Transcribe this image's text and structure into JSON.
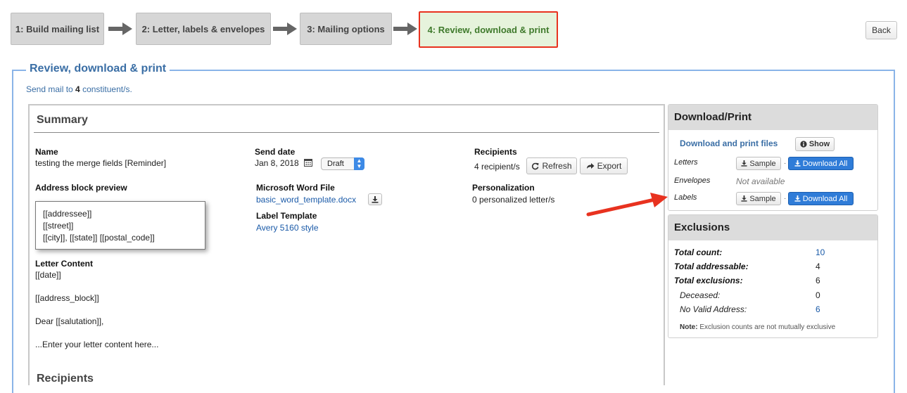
{
  "wizard": {
    "steps": [
      {
        "label": "1: Build mailing list"
      },
      {
        "label": "2: Letter, labels & envelopes"
      },
      {
        "label": "3: Mailing options"
      },
      {
        "label": "4: Review, download & print"
      }
    ],
    "back_label": "Back"
  },
  "page": {
    "legend": "Review, download & print",
    "send_prefix": "Send mail to ",
    "send_count": "4",
    "send_suffix": " constituent/s."
  },
  "summary": {
    "title": "Summary",
    "name_label": "Name",
    "name_value": "testing the merge fields [Reminder]",
    "address_label": "Address block preview",
    "address_lines": [
      "[[addressee]]",
      "[[street]]",
      "[[city]], [[state]] [[postal_code]]"
    ],
    "letter_label": "Letter Content",
    "letter_lines": [
      "[[date]]",
      "[[address_block]]",
      "Dear [[salutation]],",
      "...Enter your letter content here..."
    ],
    "send_date_label": "Send date",
    "send_date_value": "Jan 8, 2018",
    "status_value": "Draft",
    "word_label": "Microsoft Word File",
    "word_file": "basic_word_template.docx",
    "label_template_label": "Label Template",
    "label_template_value": "Avery 5160 style",
    "recipients_label": "Recipients",
    "recipients_value": "4 recipient/s",
    "refresh_label": "Refresh",
    "export_label": "Export",
    "personalization_label": "Personalization",
    "personalization_value": "0 personalized letter/s",
    "recipients_section": "Recipients"
  },
  "download": {
    "title": "Download/Print",
    "files_link": "Download and print files",
    "show_label": "Show",
    "rows": [
      {
        "label": "Letters",
        "sample": "Sample",
        "download": "Download All"
      },
      {
        "label": "Envelopes",
        "status": "Not available"
      },
      {
        "label": "Labels",
        "sample": "Sample",
        "download": "Download All"
      }
    ]
  },
  "exclusions": {
    "title": "Exclusions",
    "rows": [
      {
        "label": "Total count:",
        "value": "10"
      },
      {
        "label": "Total addressable:",
        "value": "4"
      },
      {
        "label": "Total exclusions:",
        "value": "6"
      },
      {
        "label": "Deceased:",
        "value": "0"
      },
      {
        "label": "No Valid Address:",
        "value": "6"
      }
    ],
    "note_label": "Note:",
    "note_text": " Exclusion counts are not mutually exclusive"
  },
  "colors": {
    "active_step_border": "#e8321f",
    "active_step_bg": "#e6f3dc",
    "primary_button": "#2f7cd8",
    "link": "#1a5aa8",
    "frame_border": "#8ab4e8",
    "annotation_arrow": "#e8321f"
  }
}
